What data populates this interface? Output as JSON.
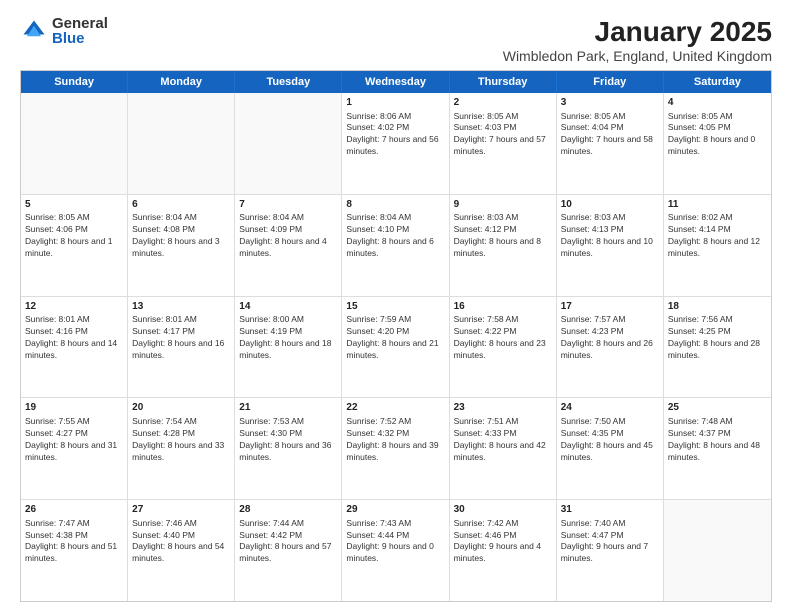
{
  "logo": {
    "general": "General",
    "blue": "Blue"
  },
  "title": "January 2025",
  "subtitle": "Wimbledon Park, England, United Kingdom",
  "days": [
    "Sunday",
    "Monday",
    "Tuesday",
    "Wednesday",
    "Thursday",
    "Friday",
    "Saturday"
  ],
  "weeks": [
    [
      {
        "day": "",
        "text": "",
        "empty": true
      },
      {
        "day": "",
        "text": "",
        "empty": true
      },
      {
        "day": "",
        "text": "",
        "empty": true
      },
      {
        "day": "1",
        "text": "Sunrise: 8:06 AM\nSunset: 4:02 PM\nDaylight: 7 hours and 56 minutes."
      },
      {
        "day": "2",
        "text": "Sunrise: 8:05 AM\nSunset: 4:03 PM\nDaylight: 7 hours and 57 minutes."
      },
      {
        "day": "3",
        "text": "Sunrise: 8:05 AM\nSunset: 4:04 PM\nDaylight: 7 hours and 58 minutes."
      },
      {
        "day": "4",
        "text": "Sunrise: 8:05 AM\nSunset: 4:05 PM\nDaylight: 8 hours and 0 minutes."
      }
    ],
    [
      {
        "day": "5",
        "text": "Sunrise: 8:05 AM\nSunset: 4:06 PM\nDaylight: 8 hours and 1 minute."
      },
      {
        "day": "6",
        "text": "Sunrise: 8:04 AM\nSunset: 4:08 PM\nDaylight: 8 hours and 3 minutes."
      },
      {
        "day": "7",
        "text": "Sunrise: 8:04 AM\nSunset: 4:09 PM\nDaylight: 8 hours and 4 minutes."
      },
      {
        "day": "8",
        "text": "Sunrise: 8:04 AM\nSunset: 4:10 PM\nDaylight: 8 hours and 6 minutes."
      },
      {
        "day": "9",
        "text": "Sunrise: 8:03 AM\nSunset: 4:12 PM\nDaylight: 8 hours and 8 minutes."
      },
      {
        "day": "10",
        "text": "Sunrise: 8:03 AM\nSunset: 4:13 PM\nDaylight: 8 hours and 10 minutes."
      },
      {
        "day": "11",
        "text": "Sunrise: 8:02 AM\nSunset: 4:14 PM\nDaylight: 8 hours and 12 minutes."
      }
    ],
    [
      {
        "day": "12",
        "text": "Sunrise: 8:01 AM\nSunset: 4:16 PM\nDaylight: 8 hours and 14 minutes."
      },
      {
        "day": "13",
        "text": "Sunrise: 8:01 AM\nSunset: 4:17 PM\nDaylight: 8 hours and 16 minutes."
      },
      {
        "day": "14",
        "text": "Sunrise: 8:00 AM\nSunset: 4:19 PM\nDaylight: 8 hours and 18 minutes."
      },
      {
        "day": "15",
        "text": "Sunrise: 7:59 AM\nSunset: 4:20 PM\nDaylight: 8 hours and 21 minutes."
      },
      {
        "day": "16",
        "text": "Sunrise: 7:58 AM\nSunset: 4:22 PM\nDaylight: 8 hours and 23 minutes."
      },
      {
        "day": "17",
        "text": "Sunrise: 7:57 AM\nSunset: 4:23 PM\nDaylight: 8 hours and 26 minutes."
      },
      {
        "day": "18",
        "text": "Sunrise: 7:56 AM\nSunset: 4:25 PM\nDaylight: 8 hours and 28 minutes."
      }
    ],
    [
      {
        "day": "19",
        "text": "Sunrise: 7:55 AM\nSunset: 4:27 PM\nDaylight: 8 hours and 31 minutes."
      },
      {
        "day": "20",
        "text": "Sunrise: 7:54 AM\nSunset: 4:28 PM\nDaylight: 8 hours and 33 minutes."
      },
      {
        "day": "21",
        "text": "Sunrise: 7:53 AM\nSunset: 4:30 PM\nDaylight: 8 hours and 36 minutes."
      },
      {
        "day": "22",
        "text": "Sunrise: 7:52 AM\nSunset: 4:32 PM\nDaylight: 8 hours and 39 minutes."
      },
      {
        "day": "23",
        "text": "Sunrise: 7:51 AM\nSunset: 4:33 PM\nDaylight: 8 hours and 42 minutes."
      },
      {
        "day": "24",
        "text": "Sunrise: 7:50 AM\nSunset: 4:35 PM\nDaylight: 8 hours and 45 minutes."
      },
      {
        "day": "25",
        "text": "Sunrise: 7:48 AM\nSunset: 4:37 PM\nDaylight: 8 hours and 48 minutes."
      }
    ],
    [
      {
        "day": "26",
        "text": "Sunrise: 7:47 AM\nSunset: 4:38 PM\nDaylight: 8 hours and 51 minutes."
      },
      {
        "day": "27",
        "text": "Sunrise: 7:46 AM\nSunset: 4:40 PM\nDaylight: 8 hours and 54 minutes."
      },
      {
        "day": "28",
        "text": "Sunrise: 7:44 AM\nSunset: 4:42 PM\nDaylight: 8 hours and 57 minutes."
      },
      {
        "day": "29",
        "text": "Sunrise: 7:43 AM\nSunset: 4:44 PM\nDaylight: 9 hours and 0 minutes."
      },
      {
        "day": "30",
        "text": "Sunrise: 7:42 AM\nSunset: 4:46 PM\nDaylight: 9 hours and 4 minutes."
      },
      {
        "day": "31",
        "text": "Sunrise: 7:40 AM\nSunset: 4:47 PM\nDaylight: 9 hours and 7 minutes."
      },
      {
        "day": "",
        "text": "",
        "empty": true
      }
    ]
  ]
}
